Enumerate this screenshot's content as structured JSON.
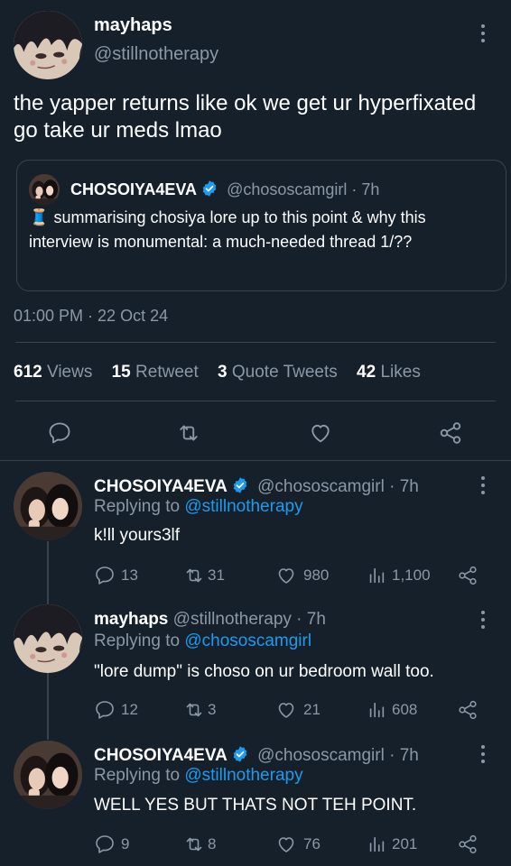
{
  "main_tweet": {
    "display_name": "mayhaps",
    "handle": "@stillnotherapy",
    "text_line1": "the yapper returns like ok we get ur hyperfixated",
    "text_line2": "go take ur meds lmao",
    "timestamp": "01:00 PM · 22 Oct 24"
  },
  "quoted_tweet": {
    "display_name": "CHOSOIYA4EVA",
    "handle": "@chososcamgirl",
    "time": "· 7h",
    "emoji": "🧵",
    "text_line1": "summarising chosiya lore up to this point & why this",
    "text_line2": "interview is monumental: a much-needed thread 1/??"
  },
  "stats": {
    "views_count": "612",
    "views_label": "Views",
    "retweets_count": "15",
    "retweets_label": "Retweet",
    "quotes_count": "3",
    "quotes_label": "Quote Tweets",
    "likes_count": "42",
    "likes_label": "Likes"
  },
  "replies": [
    {
      "display_name": "CHOSOIYA4EVA",
      "handle": "@chososcamgirl · 7h",
      "replying_prefix": "Replying to",
      "replying_to": "@stillnotherapy",
      "text": "k!ll yours3lf",
      "reply_count": "13",
      "retweet_count": "31",
      "like_count": "980",
      "view_count": "1,100"
    },
    {
      "display_name": "mayhaps",
      "handle": "@stillnotherapy · 7h",
      "replying_prefix": "Replying to",
      "replying_to": "@chososcamgirl",
      "text": "\"lore dump\" is choso on ur bedroom wall too.",
      "reply_count": "12",
      "retweet_count": "3",
      "like_count": "21",
      "view_count": "608"
    },
    {
      "display_name": "CHOSOIYA4EVA",
      "handle": "@chososcamgirl · 7h",
      "replying_prefix": "Replying to",
      "replying_to": "@stillnotherapy",
      "text": "WELL YES BUT THATS NOT TEH POINT.",
      "reply_count": "9",
      "retweet_count": "8",
      "like_count": "76",
      "view_count": "201"
    }
  ],
  "colors": {
    "background": "#15202b",
    "muted": "#8b98a5",
    "accent": "#1d9bf0",
    "divider": "#38444d"
  },
  "icons": [
    "more-icon",
    "verified-icon",
    "reply-icon",
    "retweet-icon",
    "like-icon",
    "share-icon",
    "views-icon"
  ]
}
